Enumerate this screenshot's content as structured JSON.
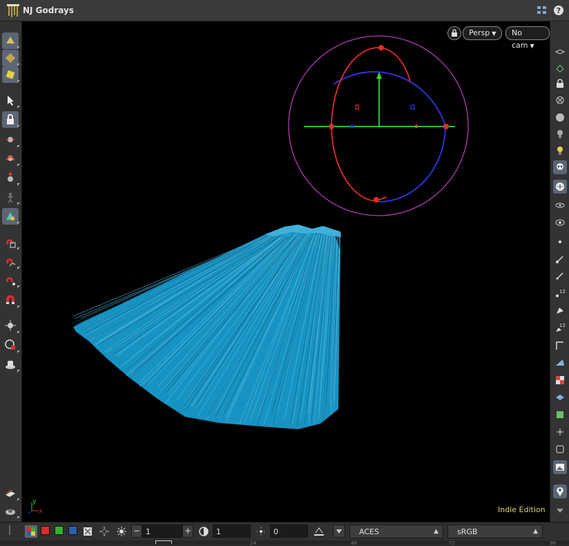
{
  "window": {
    "title": "NJ Godrays"
  },
  "viewport": {
    "persp_label": "Persp",
    "camera_label": "No cam",
    "edition_label": "Indie Edition",
    "axis_y": "y",
    "axis_x": "x",
    "geometry_color": "#1793c2",
    "background": "#000000"
  },
  "left_shelf": {
    "tools": [
      "paint-bucket-icon",
      "shade-icon",
      "object-paint-icon",
      "select-arrow-icon",
      "lock-view-icon",
      "transform-icon",
      "rotate-icon",
      "scale-icon",
      "pose-icon",
      "handle-active-icon",
      "magnet-box-icon",
      "magnet-curve-icon",
      "magnet-points-icon",
      "magnet-icon",
      "snap-icon",
      "render-region-icon",
      "camera-icon",
      "flipbook-icon",
      "stamp-icon"
    ]
  },
  "right_shelf": {
    "tools": [
      "display-options-icon",
      "ghost-icon",
      "lock-icon",
      "xray-icon",
      "shaded-icon",
      "light-icon",
      "headlight-icon",
      "skull-icon",
      "template-icon",
      "visibility-icon",
      "view-camera-icon",
      "point-icon",
      "normal-icon",
      "vector-icon",
      "point-number-icon",
      "prim-icon",
      "prim-number-icon",
      "edge-icon",
      "uv-icon",
      "checker-icon",
      "layer-icon",
      "uv-grid-icon",
      "axis-icon",
      "box-icon",
      "background-icon",
      "pin-icon"
    ]
  },
  "bottom_bar": {
    "field_minus": "1",
    "field_contrast": "1",
    "field_exposure": "0",
    "colorspace": "ACES",
    "display": "sRGB",
    "swatch_colors": [
      "#d92b2b",
      "#35b030",
      "#2d5fb0"
    ]
  },
  "ruler": {
    "ticks": [
      "24",
      "48",
      "72",
      "96"
    ]
  }
}
